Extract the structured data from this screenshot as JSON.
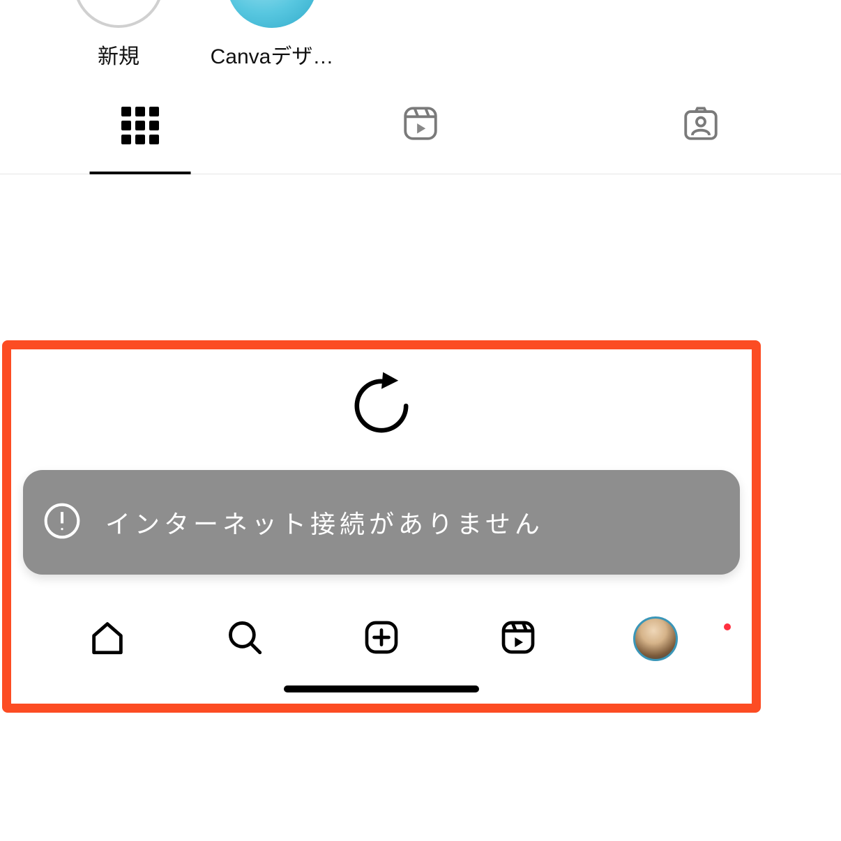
{
  "stories": [
    {
      "label": "新規"
    },
    {
      "label": "Canvaデザ…"
    }
  ],
  "tabs": {
    "grid": "grid",
    "reels": "reels",
    "tagged": "tagged"
  },
  "toast": {
    "message": "インターネット接続がありません"
  },
  "nav": {
    "home": "home",
    "search": "search",
    "create": "create",
    "reels": "reels",
    "profile": "profile"
  },
  "highlight_color": "#fc4c23"
}
